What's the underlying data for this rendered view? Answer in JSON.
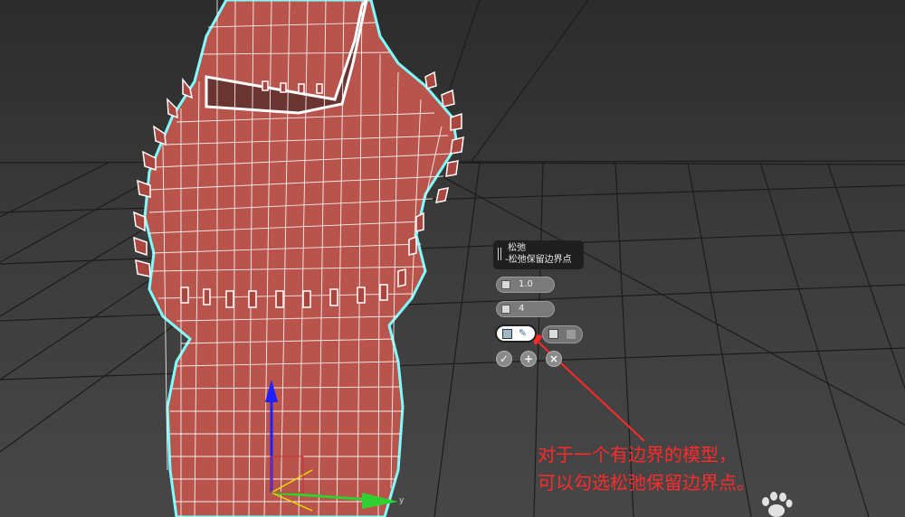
{
  "viewport": {
    "background_top": "#2c2c2c",
    "background_bottom": "#474747",
    "grid_color": "#1e1e1e",
    "model_color": "#b8544b",
    "wire_color": "#ffffff",
    "outline_color": "#7fffff"
  },
  "caddy": {
    "title": "松弛",
    "subtitle": "-松弛保留边界点",
    "amount_value": "1.0",
    "iterations_value": "4",
    "amount_icon": "relax-amount-icon",
    "iterations_icon": "iterations-icon",
    "keep_boundary_icon": "keep-boundary-icon",
    "brush_icon": "brush-icon",
    "save_outer_icon": "save-outer-corners-icon",
    "ok_label": "✓",
    "apply_label": "+",
    "cancel_label": "×"
  },
  "gizmo": {
    "y_label": "y",
    "x_color": "#2fd02f",
    "z_color": "#2020ff",
    "y_color": "#e8e000"
  },
  "annotation": {
    "line1": "对于一个有边界的模型，",
    "line2": "可以勾选松弛保留边界点。",
    "color": "#ff2a2a"
  }
}
